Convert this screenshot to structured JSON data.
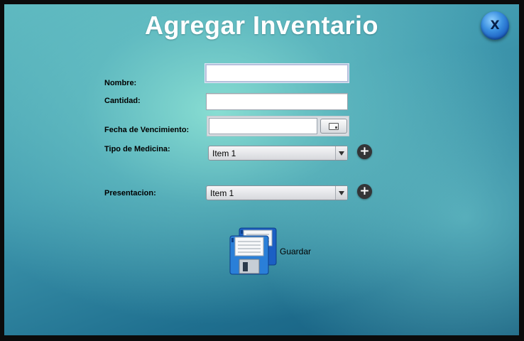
{
  "title": "Agregar Inventario",
  "close_button": {
    "label": "X"
  },
  "form": {
    "nombre": {
      "label": "Nombre:",
      "value": ""
    },
    "cantidad": {
      "label": "Cantidad:",
      "value": ""
    },
    "fecha": {
      "label": "Fecha de Vencimiento:",
      "value": ""
    },
    "tipo": {
      "label": "Tipo de Medicina:",
      "selected": "Item 1"
    },
    "presentacion": {
      "label": "Presentacion:",
      "selected": "Item 1"
    },
    "add_symbol": "+"
  },
  "save": {
    "label": "Guardar"
  },
  "icons": {
    "close": "close-icon",
    "calendar": "calendar-icon",
    "add": "plus-icon",
    "save": "floppy-disk-icon"
  },
  "colors": {
    "accent": "#2a7fd8",
    "title_text": "#ffffff"
  }
}
